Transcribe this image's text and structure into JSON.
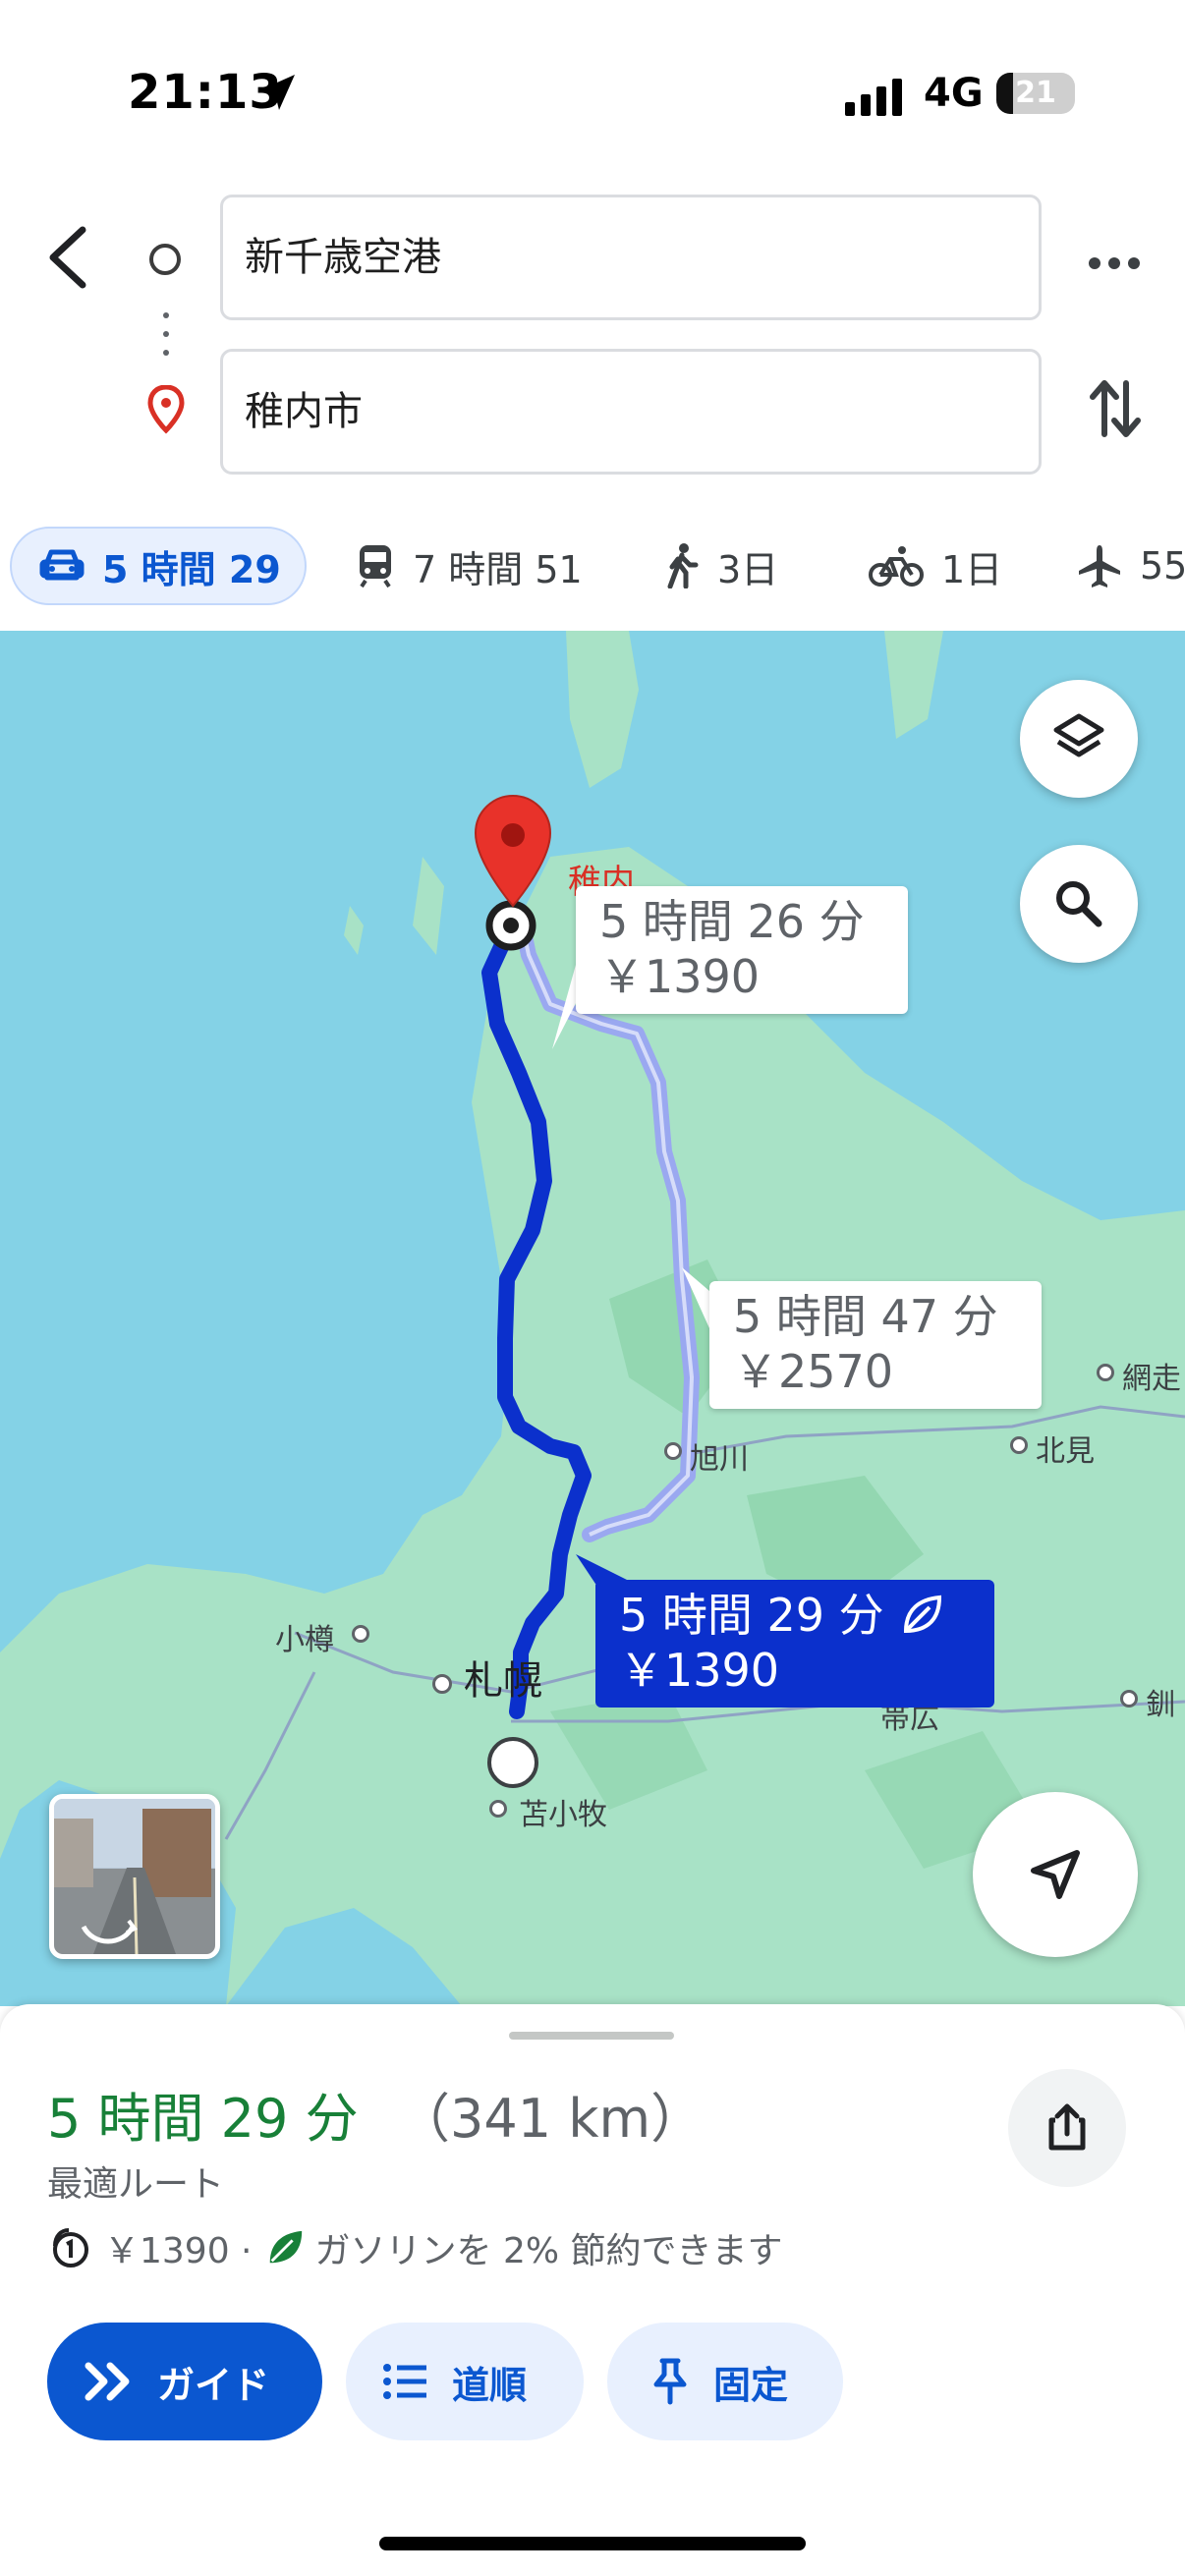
{
  "status_bar": {
    "time": "21:13",
    "network": "4G",
    "battery": "21"
  },
  "header": {
    "origin": "新千歳空港",
    "destination": "稚内市"
  },
  "mode_tabs": [
    {
      "label": "5 時間 29",
      "icon": "car-icon",
      "selected": true
    },
    {
      "label": "7 時間 51",
      "icon": "train-icon"
    },
    {
      "label": "3日",
      "icon": "walk-icon"
    },
    {
      "label": "1日",
      "icon": "bike-icon"
    },
    {
      "label": "55",
      "icon": "flight-icon"
    }
  ],
  "map": {
    "destination_label": "稚内",
    "callouts": [
      {
        "time": "5 時間 26 分",
        "price": "￥1390"
      },
      {
        "time": "5 時間 47 分",
        "price": "￥2570"
      },
      {
        "time": "5 時間 29 分",
        "price": "￥1390",
        "selected": true
      }
    ],
    "places": {
      "asahikawa": "旭川",
      "kitami": "北見",
      "abashiri": "網走",
      "otaru": "小樽",
      "sapporo": "札幌",
      "tomakomai": "苫小牧",
      "obihiro": "帯広",
      "kushiro": "釧"
    },
    "colors": {
      "water": "#84d2e6",
      "land": "#a8e2c6",
      "route": "#0b30cc",
      "alt_route": "#9aa8f0"
    }
  },
  "sheet": {
    "time": "5 時間 29 分",
    "distance": "（341 km）",
    "subtitle": "最適ルート",
    "toll": "￥1390 ·",
    "eco": "ガソリンを 2% 節約できます",
    "buttons": {
      "guide": "ガイド",
      "steps": "道順",
      "pin": "固定"
    }
  }
}
